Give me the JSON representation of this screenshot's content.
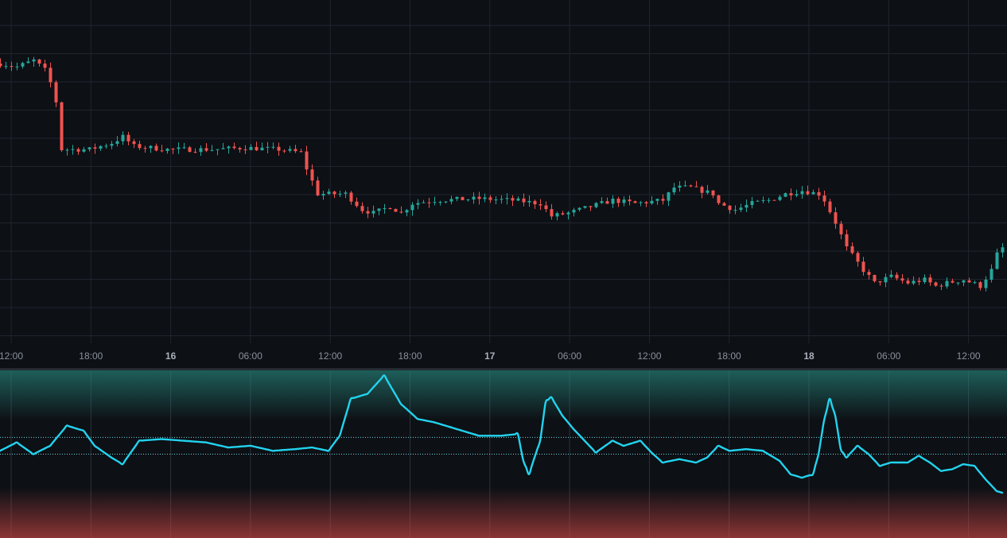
{
  "colors": {
    "background": "#0d1015",
    "grid": "#20252e",
    "up": "#26a69a",
    "down": "#ef5350",
    "indicator_line": "#22d3ee",
    "overbought_zone": "#1e5f5a",
    "oversold_zone": "#8b3434",
    "level_line": "#6fd6e0"
  },
  "time_axis": {
    "labels": [
      {
        "text": "12:00",
        "bold": false
      },
      {
        "text": "18:00",
        "bold": false
      },
      {
        "text": "16",
        "bold": true
      },
      {
        "text": "06:00",
        "bold": false
      },
      {
        "text": "12:00",
        "bold": false
      },
      {
        "text": "18:00",
        "bold": false
      },
      {
        "text": "17",
        "bold": true
      },
      {
        "text": "06:00",
        "bold": false
      },
      {
        "text": "12:00",
        "bold": false
      },
      {
        "text": "18:00",
        "bold": false
      },
      {
        "text": "18",
        "bold": true
      },
      {
        "text": "06:00",
        "bold": false
      },
      {
        "text": "12:00",
        "bold": false
      }
    ]
  },
  "chart_data": [
    {
      "type": "candlestick",
      "price_anchors": [
        [
          0,
          85
        ],
        [
          3,
          84
        ],
        [
          6,
          86
        ],
        [
          8,
          83
        ],
        [
          9,
          79
        ],
        [
          10,
          73
        ],
        [
          11,
          58
        ],
        [
          13,
          58
        ],
        [
          16,
          58
        ],
        [
          20,
          60
        ],
        [
          22,
          62
        ],
        [
          24,
          59
        ],
        [
          30,
          58
        ],
        [
          38,
          58
        ],
        [
          44,
          58.5
        ],
        [
          50,
          58
        ],
        [
          54,
          57
        ],
        [
          55,
          52
        ],
        [
          57,
          44
        ],
        [
          62,
          44
        ],
        [
          65,
          39
        ],
        [
          67,
          38
        ],
        [
          70,
          40
        ],
        [
          72,
          38
        ],
        [
          74,
          41
        ],
        [
          78,
          42
        ],
        [
          86,
          42.5
        ],
        [
          92,
          42
        ],
        [
          97,
          41
        ],
        [
          99,
          37
        ],
        [
          102,
          38
        ],
        [
          106,
          40
        ],
        [
          110,
          42
        ],
        [
          114,
          41
        ],
        [
          119,
          42
        ],
        [
          121,
          46
        ],
        [
          124,
          46
        ],
        [
          126,
          45
        ],
        [
          128,
          44
        ],
        [
          129,
          41
        ],
        [
          132,
          39
        ],
        [
          135,
          41
        ],
        [
          138,
          42
        ],
        [
          141,
          44
        ],
        [
          144,
          45
        ],
        [
          147,
          44
        ],
        [
          148,
          42
        ],
        [
          150,
          35
        ],
        [
          152,
          27
        ],
        [
          155,
          20
        ],
        [
          157,
          16
        ],
        [
          160,
          18
        ],
        [
          163,
          16
        ],
        [
          166,
          17
        ],
        [
          168,
          15
        ],
        [
          170,
          16
        ],
        [
          173,
          17
        ],
        [
          176,
          15
        ],
        [
          178,
          20
        ],
        [
          179,
          25
        ],
        [
          180,
          27
        ]
      ]
    },
    {
      "type": "line",
      "name": "oscillator",
      "ylim": [
        0,
        100
      ],
      "levels": [
        60,
        50
      ],
      "overbought_zone": [
        70,
        100
      ],
      "oversold_zone": [
        0,
        30
      ],
      "anchors": [
        [
          0,
          52
        ],
        [
          3,
          57
        ],
        [
          6,
          50
        ],
        [
          9,
          55
        ],
        [
          12,
          67
        ],
        [
          15,
          64
        ],
        [
          17,
          55
        ],
        [
          20,
          48
        ],
        [
          22,
          44
        ],
        [
          25,
          58
        ],
        [
          29,
          59
        ],
        [
          33,
          58
        ],
        [
          37,
          57
        ],
        [
          41,
          54
        ],
        [
          45,
          55
        ],
        [
          49,
          52
        ],
        [
          53,
          53
        ],
        [
          56,
          54
        ],
        [
          59,
          52
        ],
        [
          61,
          61
        ],
        [
          63,
          83
        ],
        [
          66,
          86
        ],
        [
          69,
          97
        ],
        [
          72,
          80
        ],
        [
          75,
          71
        ],
        [
          78,
          69
        ],
        [
          82,
          65
        ],
        [
          86,
          61
        ],
        [
          90,
          61
        ],
        [
          93,
          62
        ],
        [
          94,
          46
        ],
        [
          95,
          38
        ],
        [
          97,
          58
        ],
        [
          98,
          81
        ],
        [
          99,
          84
        ],
        [
          101,
          73
        ],
        [
          103,
          65
        ],
        [
          105,
          58
        ],
        [
          107,
          51
        ],
        [
          110,
          58
        ],
        [
          112,
          55
        ],
        [
          115,
          58
        ],
        [
          117,
          51
        ],
        [
          119,
          45
        ],
        [
          122,
          47
        ],
        [
          125,
          45
        ],
        [
          127,
          48
        ],
        [
          129,
          55
        ],
        [
          131,
          52
        ],
        [
          134,
          53
        ],
        [
          137,
          52
        ],
        [
          140,
          46
        ],
        [
          142,
          38
        ],
        [
          144,
          36
        ],
        [
          146,
          38
        ],
        [
          147,
          50
        ],
        [
          148,
          70
        ],
        [
          149,
          83
        ],
        [
          150,
          73
        ],
        [
          151,
          53
        ],
        [
          152,
          48
        ],
        [
          154,
          55
        ],
        [
          156,
          50
        ],
        [
          158,
          43
        ],
        [
          160,
          45
        ],
        [
          163,
          45
        ],
        [
          165,
          49
        ],
        [
          167,
          45
        ],
        [
          169,
          40
        ],
        [
          171,
          41
        ],
        [
          173,
          44
        ],
        [
          175,
          43
        ],
        [
          177,
          35
        ],
        [
          179,
          28
        ],
        [
          180,
          27
        ]
      ]
    }
  ]
}
